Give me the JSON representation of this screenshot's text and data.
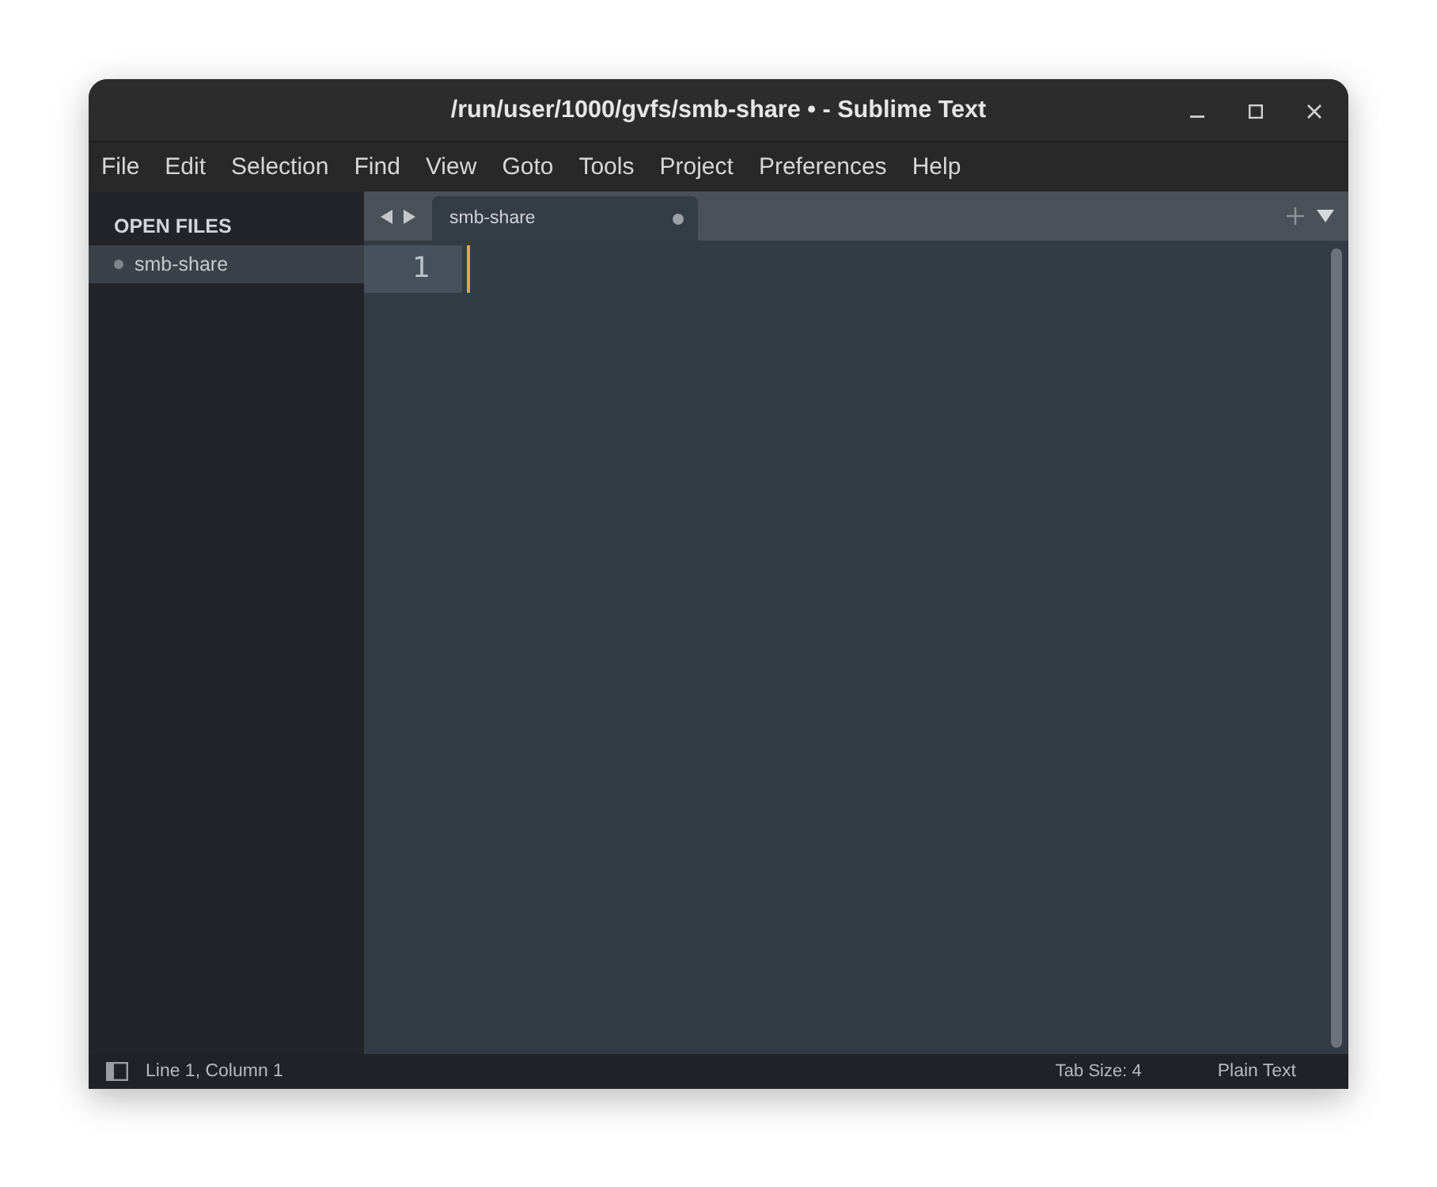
{
  "window": {
    "title": "/run/user/1000/gvfs/smb-share • - Sublime Text"
  },
  "menu": [
    "File",
    "Edit",
    "Selection",
    "Find",
    "View",
    "Goto",
    "Tools",
    "Project",
    "Preferences",
    "Help"
  ],
  "sidebar": {
    "heading": "OPEN FILES",
    "items": [
      {
        "label": "smb-share",
        "selected": true,
        "modified": true
      }
    ]
  },
  "tabs": [
    {
      "label": "smb-share",
      "selected": true,
      "modified": true
    }
  ],
  "editor": {
    "lines": [
      {
        "number": "1",
        "current": true
      }
    ]
  },
  "status_bar": {
    "position": "Line 1, Column 1",
    "tab_size": "Tab Size: 4",
    "syntax": "Plain Text"
  }
}
